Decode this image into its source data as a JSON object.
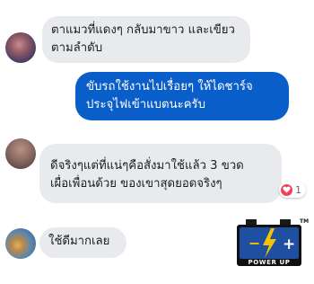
{
  "messages": [
    {
      "sender": "other",
      "lines": [
        "ตาแมวที่แดงๆ กลับมาขาว และเขียว",
        "ตามลำดับ"
      ]
    },
    {
      "sender": "self",
      "lines": [
        "ขับรถใช้งานไปเรื่อยๆ ให้ไดชาร์จ",
        "ประจุไฟเข้าแบตนะครับ"
      ]
    },
    {
      "sender": "other",
      "lines": [
        "ดีจริงๆแต่ที่แน่ๆคือสั่งมาใช้แล้ว 3 ขวด",
        "เผื่อเพื่อนด้วย ของเขาสุดยอดจริงๆ"
      ],
      "reaction": {
        "icon": "heart-icon",
        "count": "1"
      }
    },
    {
      "sender": "other",
      "lines": [
        "ใช้ดีมากเลย"
      ]
    }
  ],
  "logo": {
    "tm": "TM",
    "minus": "−",
    "plus": "+",
    "text": "POWER UP"
  },
  "colors": {
    "incoming_bubble": "#e9eaed",
    "outgoing_bubble": "#0a5ec9",
    "reaction_heart": "#f33e58",
    "logo_blue": "#1f4fa0",
    "logo_yellow": "#f5c400"
  }
}
